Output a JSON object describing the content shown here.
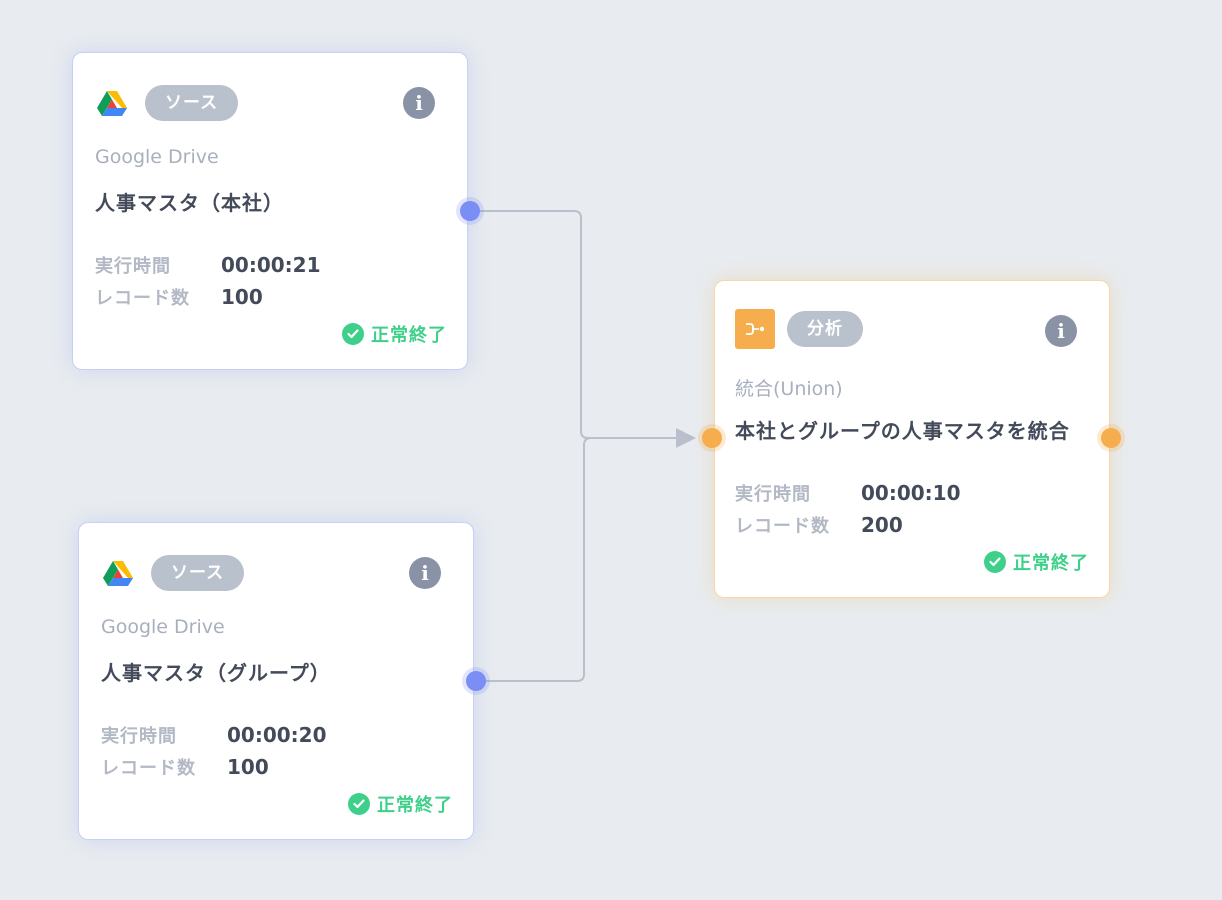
{
  "nodes": {
    "source_honsha": {
      "type_label": "ソース",
      "category": "Google Drive",
      "title": "人事マスタ（本社）",
      "exec_time_label": "実行時間",
      "exec_time": "00:00:21",
      "record_count_label": "レコード数",
      "record_count": "100",
      "status": "正常終了",
      "icon": "google-drive-icon"
    },
    "source_group": {
      "type_label": "ソース",
      "category": "Google Drive",
      "title": "人事マスタ（グループ）",
      "exec_time_label": "実行時間",
      "exec_time": "00:00:20",
      "record_count_label": "レコード数",
      "record_count": "100",
      "status": "正常終了",
      "icon": "google-drive-icon"
    },
    "union": {
      "type_label": "分析",
      "category": "統合(Union)",
      "title": "本社とグループの人事マスタを統合",
      "exec_time_label": "実行時間",
      "exec_time": "00:00:10",
      "record_count_label": "レコード数",
      "record_count": "200",
      "status": "正常終了",
      "icon": "union-merge-icon"
    }
  },
  "colors": {
    "canvas_background": "#e8ecf0",
    "source_port": "#7a8ef6",
    "analysis_port": "#f6ad4d",
    "analysis_icon_bg": "#f6ad4d",
    "badge_bg": "#b9c1cd",
    "status_success": "#3ed08a",
    "info_button": "#8a93a6",
    "edge": "#b9c0cc"
  }
}
